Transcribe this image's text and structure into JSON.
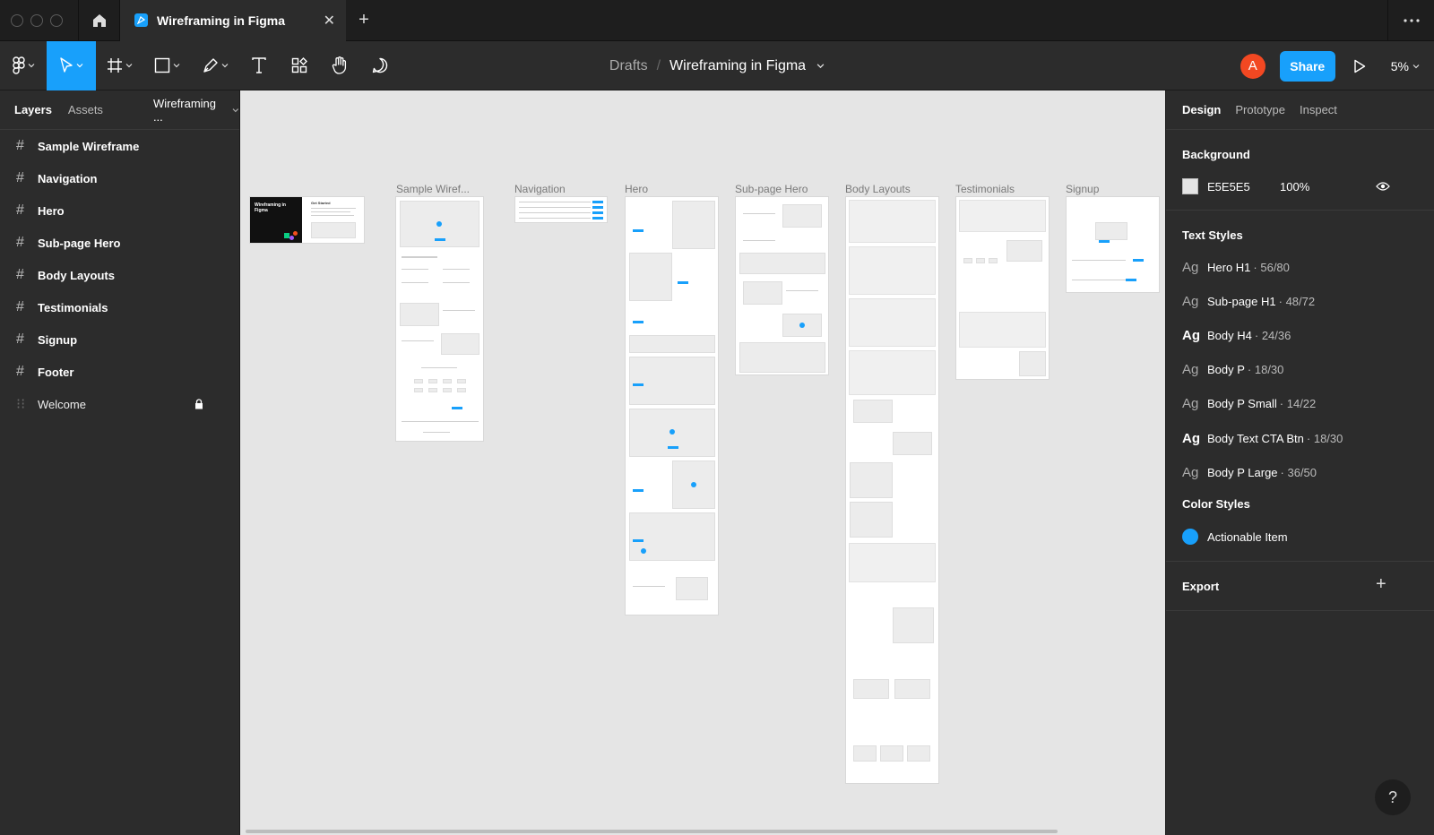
{
  "window": {
    "tab_title": "Wireframing in Figma",
    "new_tab": "+",
    "close_tab": "✕"
  },
  "toolbar": {
    "breadcrumb_parent": "Drafts",
    "breadcrumb_sep": "/",
    "file_name": "Wireframing in Figma",
    "avatar_initial": "A",
    "share_label": "Share",
    "zoom": "5%"
  },
  "left_panel": {
    "tabs": {
      "layers": "Layers",
      "assets": "Assets"
    },
    "page_name": "Wireframing ...",
    "layers": [
      {
        "label": "Sample Wireframe"
      },
      {
        "label": "Navigation"
      },
      {
        "label": "Hero"
      },
      {
        "label": "Sub-page Hero"
      },
      {
        "label": "Body Layouts"
      },
      {
        "label": "Testimonials"
      },
      {
        "label": "Signup"
      },
      {
        "label": "Footer"
      },
      {
        "label": "Welcome"
      }
    ]
  },
  "canvas": {
    "background": "#E5E5E5",
    "frames": {
      "cover": "",
      "sample": "Sample Wiref...",
      "navigation": "Navigation",
      "hero": "Hero",
      "subpage_hero": "Sub-page Hero",
      "body_layouts": "Body Layouts",
      "testimonials": "Testimonials",
      "signup": "Signup"
    },
    "cover_title": "Wireframing in Figma",
    "cover_subtitle": "Get Started"
  },
  "right_panel": {
    "tabs": {
      "design": "Design",
      "prototype": "Prototype",
      "inspect": "Inspect"
    },
    "background_title": "Background",
    "background_hex": "E5E5E5",
    "background_opacity": "100%",
    "text_styles_title": "Text Styles",
    "text_styles": [
      {
        "ag": "Ag",
        "name": "Hero H1",
        "spec": "· 56/80",
        "bold": false
      },
      {
        "ag": "Ag",
        "name": "Sub-page H1",
        "spec": "· 48/72",
        "bold": false
      },
      {
        "ag": "Ag",
        "name": "Body H4",
        "spec": "· 24/36",
        "bold": true
      },
      {
        "ag": "Ag",
        "name": "Body P",
        "spec": "· 18/30",
        "bold": false
      },
      {
        "ag": "Ag",
        "name": "Body P Small",
        "spec": "· 14/22",
        "bold": false
      },
      {
        "ag": "Ag",
        "name": "Body Text CTA Btn",
        "spec": "· 18/30",
        "bold": true
      },
      {
        "ag": "Ag",
        "name": "Body P Large",
        "spec": "· 36/50",
        "bold": false
      }
    ],
    "color_styles_title": "Color Styles",
    "color_style": {
      "name": "Actionable Item",
      "color": "#18A0FB"
    },
    "export_title": "Export",
    "export_add": "+"
  },
  "help": "?"
}
